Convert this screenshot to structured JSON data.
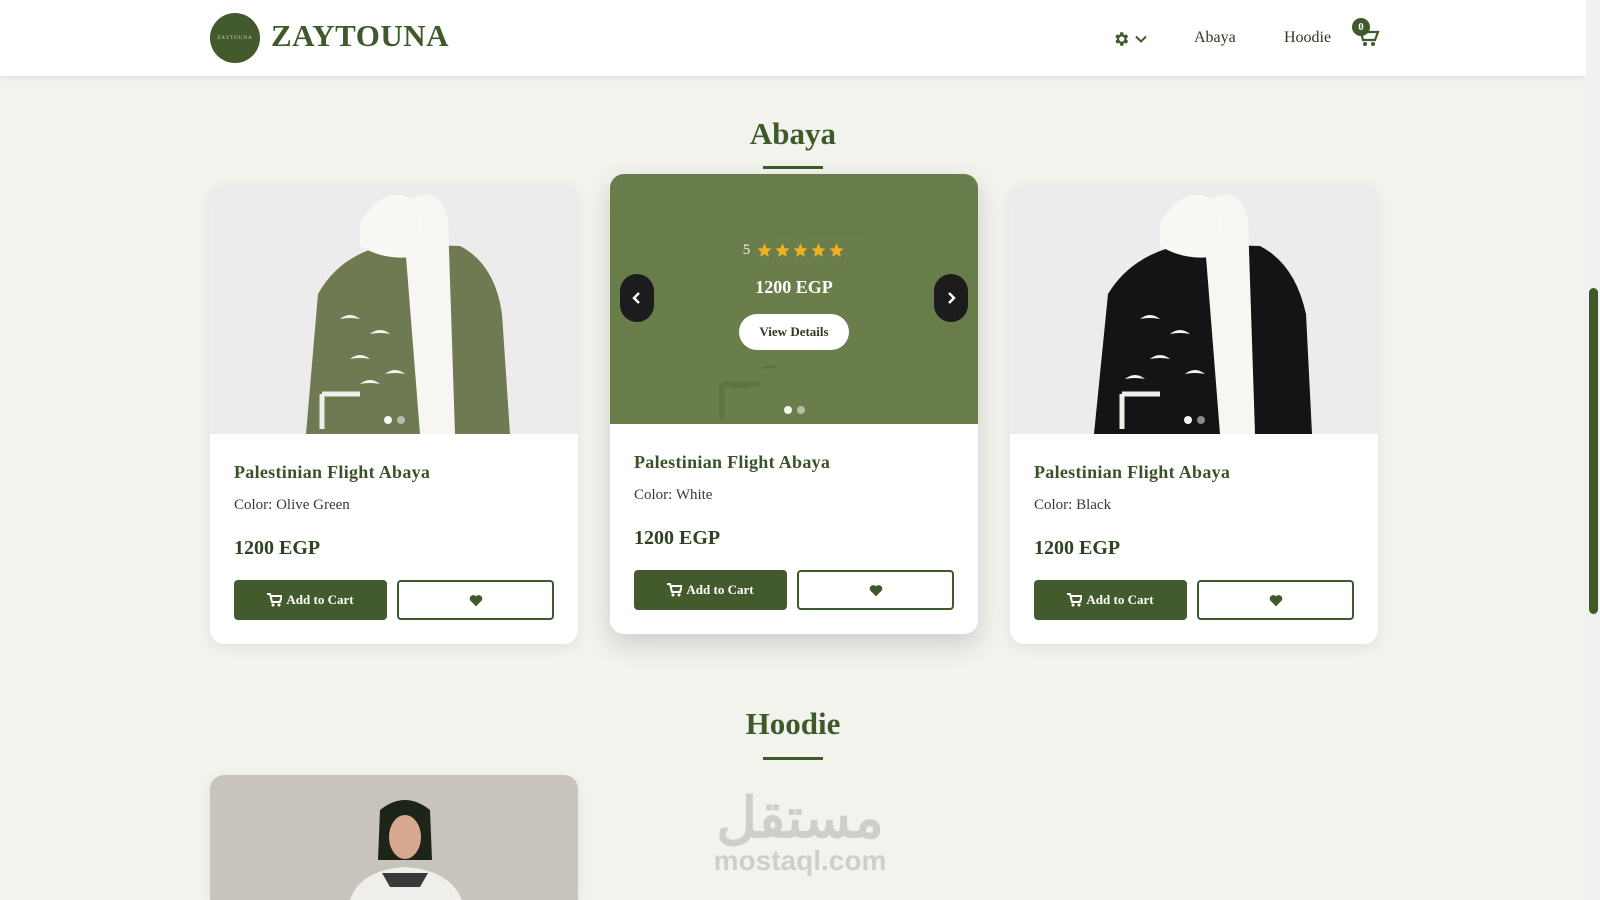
{
  "brand": {
    "name": "ZAYTOUNA",
    "logo_text": "ZAYTOUNA"
  },
  "nav": {
    "settings_icon": "gear-icon",
    "links": [
      "Abaya",
      "Hoodie"
    ],
    "cart_count": "0"
  },
  "colors": {
    "primary": "#3f5a2a",
    "button": "#435a2c",
    "overlay": "#5f743e",
    "background": "#f3f3ee",
    "star": "#f2b01e"
  },
  "sections": [
    {
      "title": "Abaya",
      "products": [
        {
          "name": "Palestinian Flight Abaya",
          "color": "Color: Olive Green",
          "price": "1200 EGP",
          "add_label": "Add to Cart"
        },
        {
          "name": "Palestinian Flight Abaya",
          "color": "Color: White",
          "price": "1200 EGP",
          "add_label": "Add to Cart",
          "overlay": {
            "rating": "5",
            "stars": 5,
            "price": "1200 EGP",
            "view_label": "View Details"
          }
        },
        {
          "name": "Palestinian Flight Abaya",
          "color": "Color: Black",
          "price": "1200 EGP",
          "add_label": "Add to Cart"
        }
      ]
    },
    {
      "title": "Hoodie"
    }
  ],
  "watermark": {
    "arabic": "مستقل",
    "latin": "mostaql.com"
  }
}
